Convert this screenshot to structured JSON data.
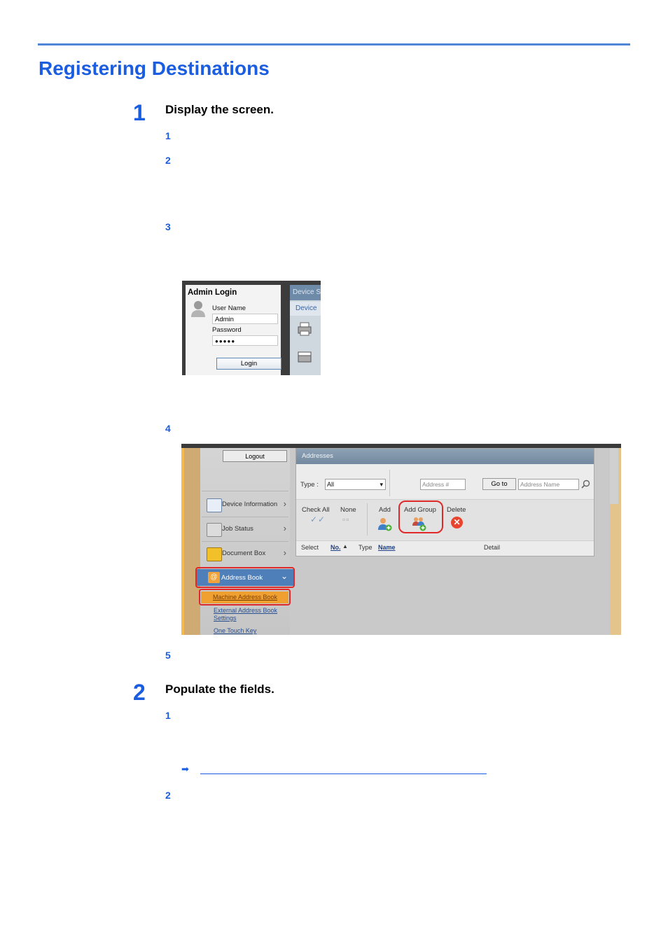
{
  "page": {
    "title": "Registering Destinations"
  },
  "step1": {
    "number": "1",
    "title": "Display the screen.",
    "substeps": [
      "1",
      "2",
      "3",
      "4",
      "5"
    ]
  },
  "login_screenshot": {
    "title": "Admin Login",
    "user_name_label": "User Name",
    "user_name_value": "Admin",
    "password_label": "Password",
    "password_value": "●●●●●",
    "login_button": "Login",
    "right_tab": "Device S",
    "right_sub": "Device"
  },
  "addressbook_screenshot": {
    "logout": "Logout",
    "nav": {
      "device_information": "Device Information",
      "job_status": "Job Status",
      "document_box": "Document Box",
      "address_book": "Address Book",
      "machine_address_book": "Machine Address Book",
      "external_address_book_1": "External Address Book",
      "external_address_book_2": "Settings",
      "one_touch_key": "One Touch Key"
    },
    "panel": {
      "header": "Addresses",
      "type_label": "Type :",
      "type_value": "All",
      "address_no_placeholder": "Address #",
      "goto_button": "Go to",
      "address_name_placeholder": "Address Name",
      "check_all": "Check All",
      "none": "None",
      "add": "Add",
      "add_group": "Add Group",
      "delete": "Delete",
      "columns": {
        "select": "Select",
        "no": "No.",
        "type": "Type",
        "name": "Name",
        "detail": "Detail"
      }
    }
  },
  "step2": {
    "number": "2",
    "title": "Populate the fields.",
    "substeps": [
      "1",
      "2"
    ]
  },
  "link_arrow": "➡",
  "colors": {
    "accent": "#1a5de0",
    "rule": "#4f86d8",
    "highlight": "#e02a2a"
  },
  "icons": [
    "user-icon",
    "printer-icon",
    "scanner-icon",
    "device-info-icon",
    "job-status-icon",
    "document-box-icon",
    "address-book-icon",
    "add-user-icon",
    "add-group-icon",
    "delete-icon",
    "search-icon",
    "chevron-right-icon",
    "chevron-down-icon",
    "arrow-right-icon"
  ]
}
